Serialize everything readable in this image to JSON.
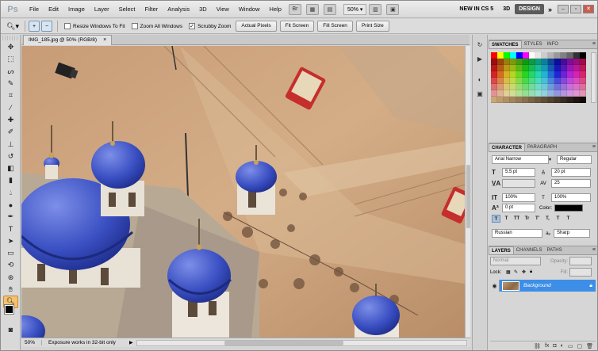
{
  "app": {
    "logo": "Ps"
  },
  "menubar": {
    "items": [
      "File",
      "Edit",
      "Image",
      "Layer",
      "Select",
      "Filter",
      "Analysis",
      "3D",
      "View",
      "Window",
      "Help"
    ],
    "zoom": "50%",
    "workspace_new": "NEW IN CS 5",
    "workspace_3d": "3D",
    "workspace_active": "DESIGN",
    "more": "»"
  },
  "options": {
    "resize_windows": "Resize Windows To Fit",
    "zoom_all": "Zoom All Windows",
    "scrubby": "Scrubby Zoom",
    "actual_pixels": "Actual Pixels",
    "fit_screen": "Fit Screen",
    "fill_screen": "Fill Screen",
    "print_size": "Print Size"
  },
  "document": {
    "tab_title": "IMG_185.jpg @ 50% (RGB/8)",
    "close": "×"
  },
  "status": {
    "zoom": "50%",
    "info": "Exposure works in 32-bit only"
  },
  "swatches_panel": {
    "tab_swatches": "SWATCHES",
    "tab_styles": "STYLES",
    "tab_info": "INFO"
  },
  "character_panel": {
    "tab_character": "CHARACTER",
    "tab_paragraph": "PARAGRAPH",
    "font_family": "Arial Narrow",
    "font_style": "Regular",
    "font_size": "5.5 pt",
    "leading": "20 pt",
    "kerning": "",
    "tracking": "25",
    "vertical_scale": "100%",
    "horizontal_scale": "100%",
    "baseline_shift": "0 pt",
    "color_label": "Color:",
    "language": "Russian",
    "anti_alias": "Sharp",
    "type_buttons": [
      "T",
      "T",
      "TT",
      "Tr",
      "T'",
      "T,",
      "T",
      "T"
    ]
  },
  "layers_panel": {
    "tab_layers": "LAYERS",
    "tab_channels": "CHANNELS",
    "tab_paths": "PATHS",
    "blend_mode": "Normal",
    "opacity_label": "Opacity:",
    "lock_label": "Lock:",
    "fill_label": "Fill:",
    "layer_name": "Background"
  },
  "colors": {
    "accent": "#3d8ee6",
    "fg": "#000000",
    "bg": "#ffffff"
  }
}
